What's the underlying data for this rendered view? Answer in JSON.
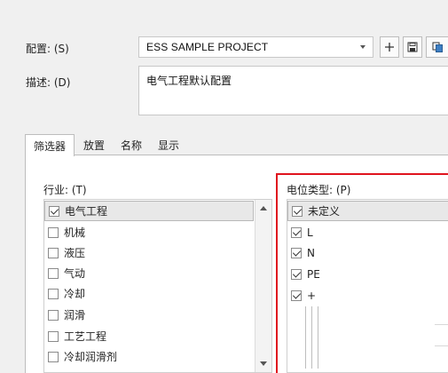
{
  "form": {
    "config_label": "配置: (S)",
    "config_value": "ESS SAMPLE PROJECT",
    "desc_label": "描述: (D)",
    "desc_value": "电气工程默认配置"
  },
  "toolbar": {
    "add_icon": "plus-icon",
    "save_icon": "save-icon",
    "copy_icon": "copy-icon"
  },
  "tabs": [
    {
      "label": "筛选器"
    },
    {
      "label": "放置"
    },
    {
      "label": "名称"
    },
    {
      "label": "显示"
    }
  ],
  "industry": {
    "label": "行业: (T)",
    "items": [
      {
        "label": "电气工程",
        "checked": true
      },
      {
        "label": "机械",
        "checked": false
      },
      {
        "label": "液压",
        "checked": false
      },
      {
        "label": "气动",
        "checked": false
      },
      {
        "label": "冷却",
        "checked": false
      },
      {
        "label": "润滑",
        "checked": false
      },
      {
        "label": "工艺工程",
        "checked": false
      },
      {
        "label": "冷却润滑剂",
        "checked": false
      }
    ]
  },
  "potential": {
    "label": "电位类型: (P)",
    "items": [
      {
        "label": "未定义",
        "checked": true
      },
      {
        "label": "L",
        "checked": true
      },
      {
        "label": "N",
        "checked": true
      },
      {
        "label": "PE",
        "checked": true
      },
      {
        "label": "+",
        "checked": true
      }
    ]
  },
  "colors": {
    "highlight": "#e0141e",
    "selection": "#e8e8e8"
  }
}
